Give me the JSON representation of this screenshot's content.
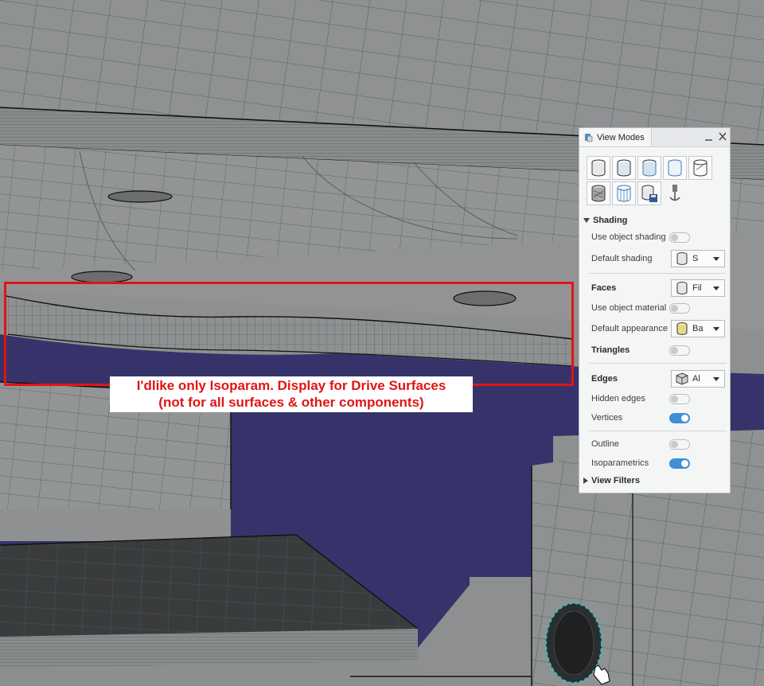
{
  "annotation": {
    "line1": "I'dlike only Isoparam. Display for Drive Surfaces",
    "line2": "(not for all surfaces & other components)"
  },
  "panel": {
    "title": "View Modes",
    "toolbar_icons": [
      "shading-icon",
      "shading-with-edges-icon",
      "shading-with-hidden-edges-icon",
      "shading-with-material-icon",
      "wireframe-icon",
      "shading-with-texture-icon",
      "customized-view-icon",
      "save-view-icon",
      "anchor-icon"
    ],
    "shading": {
      "section_label": "Shading",
      "use_object_shading": {
        "label": "Use object shading",
        "on": false
      },
      "default_shading": {
        "label": "Default shading",
        "value": "S"
      }
    },
    "faces": {
      "label": "Faces",
      "value": "Fil",
      "use_object_material": {
        "label": "Use object material",
        "on": false
      },
      "default_appearance": {
        "label": "Default appearance",
        "value": "Ba"
      },
      "triangles": {
        "label": "Triangles",
        "on": false
      }
    },
    "edges": {
      "label": "Edges",
      "value": "Al",
      "hidden_edges": {
        "label": "Hidden edges",
        "on": false
      },
      "vertices": {
        "label": "Vertices",
        "on": true
      }
    },
    "outline": {
      "label": "Outline",
      "on": false
    },
    "isoparametrics": {
      "label": "Isoparametrics",
      "on": true
    },
    "view_filters": {
      "label": "View Filters"
    }
  },
  "colors": {
    "highlight": "#e11414",
    "toggle_on": "#3d8fd6",
    "solid_blue": "#35336a"
  }
}
